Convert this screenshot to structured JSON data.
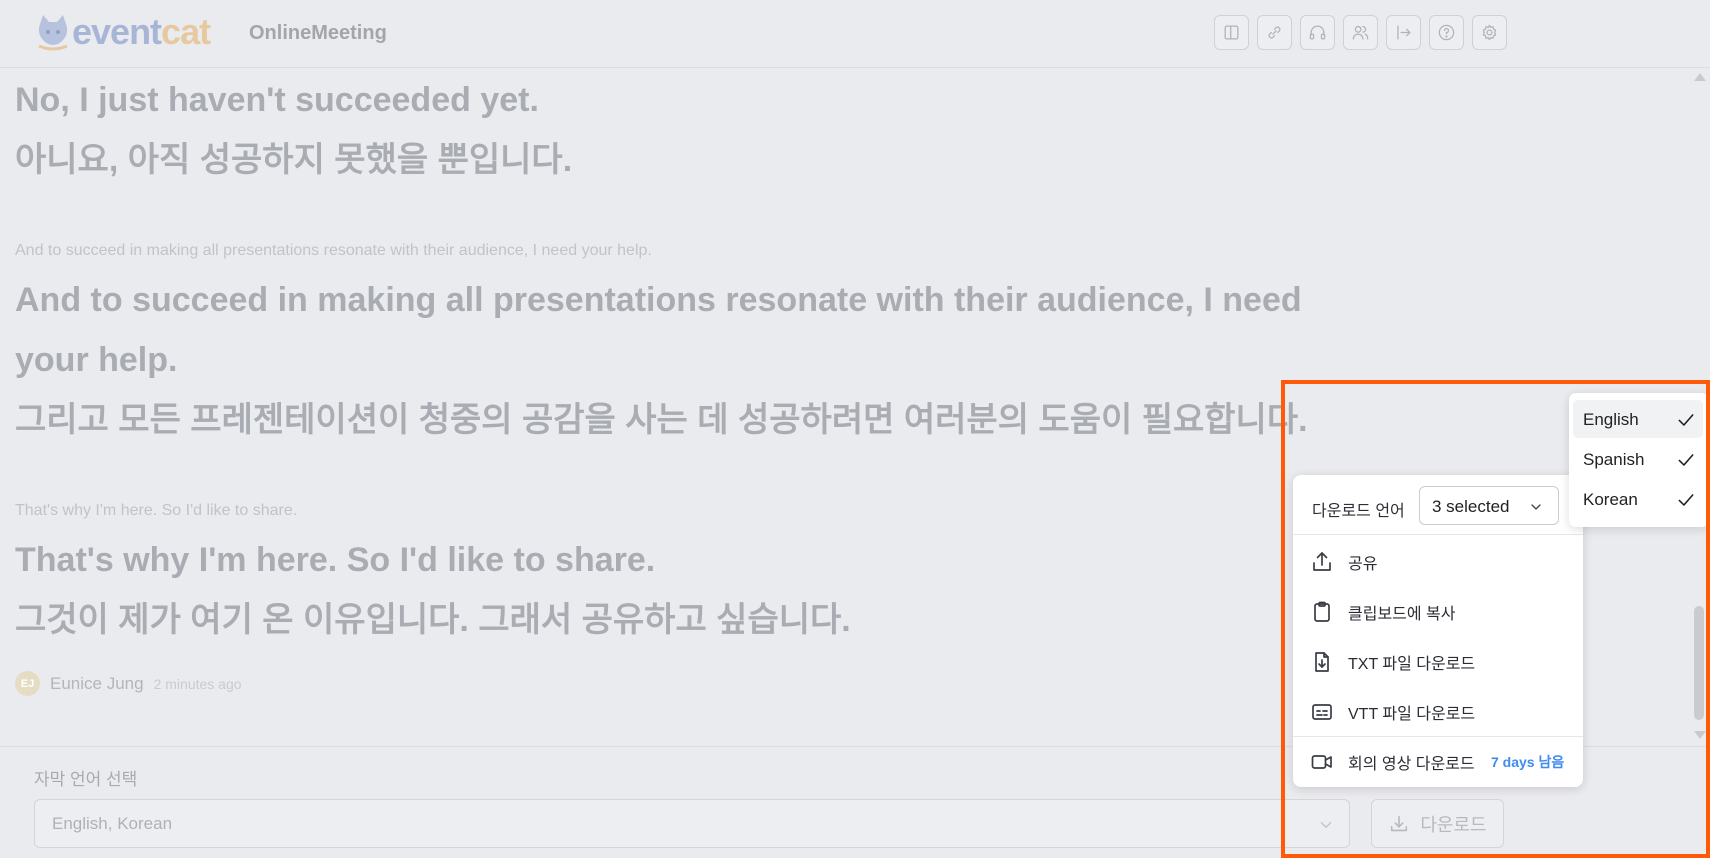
{
  "header": {
    "logo_part1": "event",
    "logo_part2": "cat",
    "app_name": "OnlineMeeting",
    "toolbar_icons": [
      "layout-icon",
      "link-icon",
      "headphones-icon",
      "users-icon",
      "exit-icon",
      "help-icon",
      "settings-icon"
    ]
  },
  "transcript": {
    "blocks": [
      {
        "lines": [
          "No, I just haven't succeeded yet.",
          "아니요, 아직 성공하지 못했을 뿐입니다."
        ]
      },
      {
        "source": "And to succeed in making all presentations resonate with their audience, I need your help.",
        "lines": [
          "And to succeed in making all presentations resonate with their audience, I need",
          "your help.",
          "그리고 모든 프레젠테이션이 청중의 공감을 사는 데 성공하려면 여러분의 도움이 필요합니다."
        ]
      },
      {
        "source": "That's why I'm here. So I'd like to share.",
        "lines": [
          "That's why I'm here. So I'd like to share.",
          "그것이 제가 여기 온 이유입니다. 그래서 공유하고 싶습니다."
        ]
      }
    ],
    "speaker": {
      "initials": "EJ",
      "name": "Eunice Jung",
      "time": "2 minutes ago"
    }
  },
  "footer": {
    "subtitle_label": "자막 언어 선택",
    "subtitle_value": "English, Korean",
    "download_label": "다운로드"
  },
  "share_menu": {
    "download_lang_label": "다운로드 언어",
    "selected_summary": "3 selected",
    "items": [
      {
        "label": "공유",
        "icon": "share-icon"
      },
      {
        "label": "클립보드에 복사",
        "icon": "clipboard-icon"
      },
      {
        "label": "TXT 파일 다운로드",
        "icon": "file-download-icon"
      },
      {
        "label": "VTT 파일 다운로드",
        "icon": "subtitles-icon"
      },
      {
        "label": "회의 영상 다운로드",
        "icon": "video-icon",
        "badge": "7 days 남음"
      }
    ]
  },
  "language_dropdown": {
    "options": [
      {
        "label": "English",
        "checked": true
      },
      {
        "label": "Spanish",
        "checked": true
      },
      {
        "label": "Korean",
        "checked": true
      }
    ]
  },
  "colors": {
    "highlight": "#ff5a0a",
    "badge": "#3f8bf0"
  }
}
